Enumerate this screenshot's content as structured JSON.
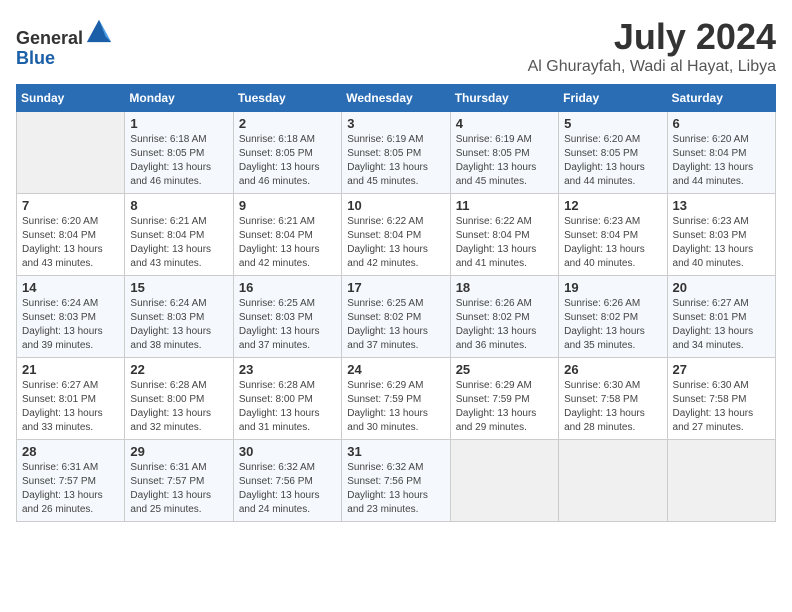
{
  "header": {
    "logo_line1": "General",
    "logo_line2": "Blue",
    "month_title": "July 2024",
    "location": "Al Ghurayfah, Wadi al Hayat, Libya"
  },
  "weekdays": [
    "Sunday",
    "Monday",
    "Tuesday",
    "Wednesday",
    "Thursday",
    "Friday",
    "Saturday"
  ],
  "weeks": [
    [
      {
        "day": "",
        "empty": true
      },
      {
        "day": "1",
        "sunrise": "6:18 AM",
        "sunset": "8:05 PM",
        "daylight": "13 hours and 46 minutes."
      },
      {
        "day": "2",
        "sunrise": "6:18 AM",
        "sunset": "8:05 PM",
        "daylight": "13 hours and 46 minutes."
      },
      {
        "day": "3",
        "sunrise": "6:19 AM",
        "sunset": "8:05 PM",
        "daylight": "13 hours and 45 minutes."
      },
      {
        "day": "4",
        "sunrise": "6:19 AM",
        "sunset": "8:05 PM",
        "daylight": "13 hours and 45 minutes."
      },
      {
        "day": "5",
        "sunrise": "6:20 AM",
        "sunset": "8:05 PM",
        "daylight": "13 hours and 44 minutes."
      },
      {
        "day": "6",
        "sunrise": "6:20 AM",
        "sunset": "8:04 PM",
        "daylight": "13 hours and 44 minutes."
      }
    ],
    [
      {
        "day": "7",
        "sunrise": "6:20 AM",
        "sunset": "8:04 PM",
        "daylight": "13 hours and 43 minutes."
      },
      {
        "day": "8",
        "sunrise": "6:21 AM",
        "sunset": "8:04 PM",
        "daylight": "13 hours and 43 minutes."
      },
      {
        "day": "9",
        "sunrise": "6:21 AM",
        "sunset": "8:04 PM",
        "daylight": "13 hours and 42 minutes."
      },
      {
        "day": "10",
        "sunrise": "6:22 AM",
        "sunset": "8:04 PM",
        "daylight": "13 hours and 42 minutes."
      },
      {
        "day": "11",
        "sunrise": "6:22 AM",
        "sunset": "8:04 PM",
        "daylight": "13 hours and 41 minutes."
      },
      {
        "day": "12",
        "sunrise": "6:23 AM",
        "sunset": "8:04 PM",
        "daylight": "13 hours and 40 minutes."
      },
      {
        "day": "13",
        "sunrise": "6:23 AM",
        "sunset": "8:03 PM",
        "daylight": "13 hours and 40 minutes."
      }
    ],
    [
      {
        "day": "14",
        "sunrise": "6:24 AM",
        "sunset": "8:03 PM",
        "daylight": "13 hours and 39 minutes."
      },
      {
        "day": "15",
        "sunrise": "6:24 AM",
        "sunset": "8:03 PM",
        "daylight": "13 hours and 38 minutes."
      },
      {
        "day": "16",
        "sunrise": "6:25 AM",
        "sunset": "8:03 PM",
        "daylight": "13 hours and 37 minutes."
      },
      {
        "day": "17",
        "sunrise": "6:25 AM",
        "sunset": "8:02 PM",
        "daylight": "13 hours and 37 minutes."
      },
      {
        "day": "18",
        "sunrise": "6:26 AM",
        "sunset": "8:02 PM",
        "daylight": "13 hours and 36 minutes."
      },
      {
        "day": "19",
        "sunrise": "6:26 AM",
        "sunset": "8:02 PM",
        "daylight": "13 hours and 35 minutes."
      },
      {
        "day": "20",
        "sunrise": "6:27 AM",
        "sunset": "8:01 PM",
        "daylight": "13 hours and 34 minutes."
      }
    ],
    [
      {
        "day": "21",
        "sunrise": "6:27 AM",
        "sunset": "8:01 PM",
        "daylight": "13 hours and 33 minutes."
      },
      {
        "day": "22",
        "sunrise": "6:28 AM",
        "sunset": "8:00 PM",
        "daylight": "13 hours and 32 minutes."
      },
      {
        "day": "23",
        "sunrise": "6:28 AM",
        "sunset": "8:00 PM",
        "daylight": "13 hours and 31 minutes."
      },
      {
        "day": "24",
        "sunrise": "6:29 AM",
        "sunset": "7:59 PM",
        "daylight": "13 hours and 30 minutes."
      },
      {
        "day": "25",
        "sunrise": "6:29 AM",
        "sunset": "7:59 PM",
        "daylight": "13 hours and 29 minutes."
      },
      {
        "day": "26",
        "sunrise": "6:30 AM",
        "sunset": "7:58 PM",
        "daylight": "13 hours and 28 minutes."
      },
      {
        "day": "27",
        "sunrise": "6:30 AM",
        "sunset": "7:58 PM",
        "daylight": "13 hours and 27 minutes."
      }
    ],
    [
      {
        "day": "28",
        "sunrise": "6:31 AM",
        "sunset": "7:57 PM",
        "daylight": "13 hours and 26 minutes."
      },
      {
        "day": "29",
        "sunrise": "6:31 AM",
        "sunset": "7:57 PM",
        "daylight": "13 hours and 25 minutes."
      },
      {
        "day": "30",
        "sunrise": "6:32 AM",
        "sunset": "7:56 PM",
        "daylight": "13 hours and 24 minutes."
      },
      {
        "day": "31",
        "sunrise": "6:32 AM",
        "sunset": "7:56 PM",
        "daylight": "13 hours and 23 minutes."
      },
      {
        "day": "",
        "empty": true
      },
      {
        "day": "",
        "empty": true
      },
      {
        "day": "",
        "empty": true
      }
    ]
  ]
}
